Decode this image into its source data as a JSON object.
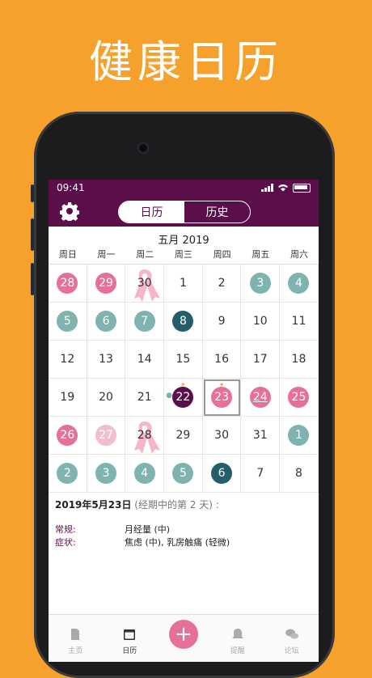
{
  "headline": "健康日历",
  "status": {
    "time": "09:41"
  },
  "segments": {
    "calendar": "日历",
    "history": "历史"
  },
  "month_title": "五月 2019",
  "weekdays": [
    "周日",
    "周一",
    "周二",
    "周三",
    "周四",
    "周五",
    "周六"
  ],
  "days": [
    {
      "n": "28",
      "style": "pink"
    },
    {
      "n": "29",
      "style": "pink"
    },
    {
      "n": "30",
      "style": "plain",
      "ribbon": true
    },
    {
      "n": "1",
      "style": "plain"
    },
    {
      "n": "2",
      "style": "plain"
    },
    {
      "n": "3",
      "style": "teal"
    },
    {
      "n": "4",
      "style": "teal"
    },
    {
      "n": "5",
      "style": "teal"
    },
    {
      "n": "6",
      "style": "teal"
    },
    {
      "n": "7",
      "style": "teal"
    },
    {
      "n": "8",
      "style": "dteal"
    },
    {
      "n": "9",
      "style": "plain"
    },
    {
      "n": "10",
      "style": "plain"
    },
    {
      "n": "11",
      "style": "plain"
    },
    {
      "n": "12",
      "style": "plain"
    },
    {
      "n": "13",
      "style": "plain"
    },
    {
      "n": "14",
      "style": "plain"
    },
    {
      "n": "15",
      "style": "plain"
    },
    {
      "n": "16",
      "style": "plain"
    },
    {
      "n": "17",
      "style": "plain"
    },
    {
      "n": "18",
      "style": "plain"
    },
    {
      "n": "19",
      "style": "plain"
    },
    {
      "n": "20",
      "style": "plain"
    },
    {
      "n": "21",
      "style": "plain"
    },
    {
      "n": "22",
      "style": "dark",
      "star": true,
      "marker": true
    },
    {
      "n": "23",
      "style": "pink",
      "star": true,
      "selected": true
    },
    {
      "n": "24",
      "style": "pink",
      "underline": true
    },
    {
      "n": "25",
      "style": "pink"
    },
    {
      "n": "26",
      "style": "pink"
    },
    {
      "n": "27",
      "style": "pinklight"
    },
    {
      "n": "28",
      "style": "plain",
      "ribbon": true
    },
    {
      "n": "29",
      "style": "plain"
    },
    {
      "n": "30",
      "style": "plain"
    },
    {
      "n": "31",
      "style": "plain"
    },
    {
      "n": "1",
      "style": "teal"
    },
    {
      "n": "2",
      "style": "teal"
    },
    {
      "n": "3",
      "style": "teal"
    },
    {
      "n": "4",
      "style": "teal"
    },
    {
      "n": "5",
      "style": "teal"
    },
    {
      "n": "6",
      "style": "dteal"
    },
    {
      "n": "7",
      "style": "plain"
    },
    {
      "n": "8",
      "style": "plain"
    }
  ],
  "detail": {
    "date": "2019年5月23日",
    "period_note": "(经期中的第 2 天) :",
    "general_label": "常规:",
    "general_value": "月经量 (中)",
    "symptom_label": "症状:",
    "symptom_value": "焦虑 (中), 乳房触痛 (轻微)"
  },
  "tabs": {
    "home": "主页",
    "calendar": "日历",
    "add": "+",
    "reminder": "提醒",
    "forum": "论坛"
  },
  "colors": {
    "background": "#F6A12B",
    "nav": "#5a0f4a",
    "period": "#E6709A",
    "fertile": "#7FB3AF",
    "ovulation": "#245E6A"
  }
}
